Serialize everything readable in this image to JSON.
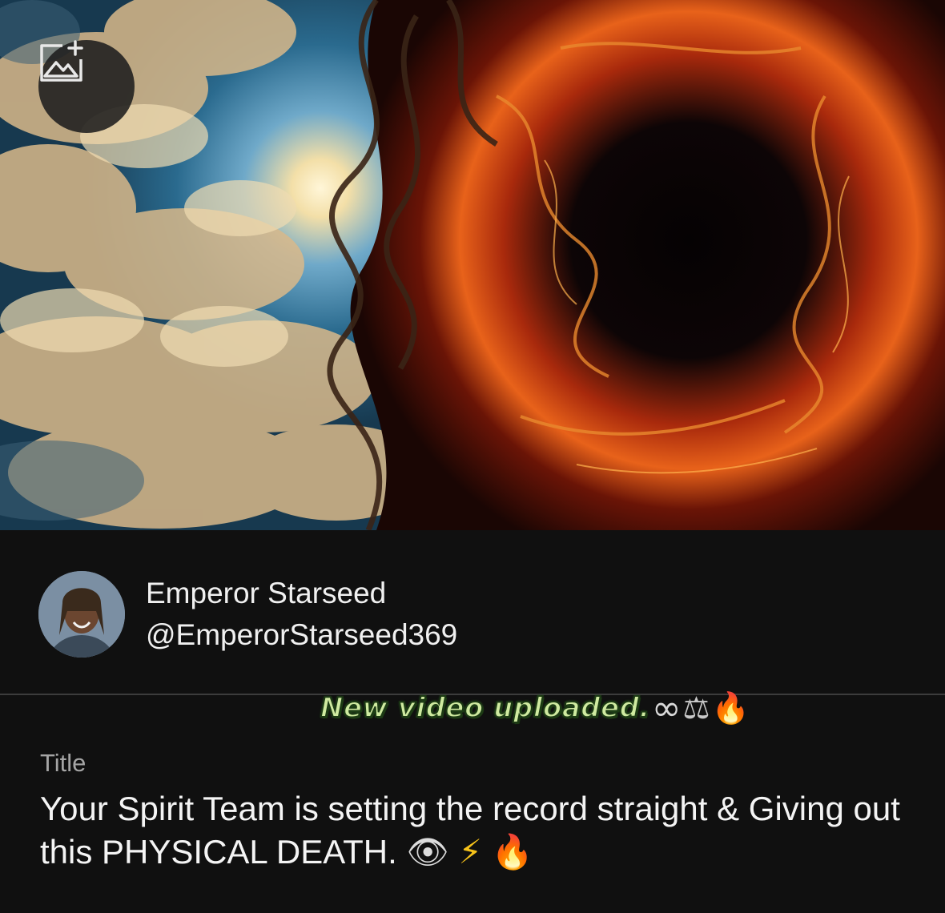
{
  "cover": {
    "add_image_icon": "image-add-icon"
  },
  "author": {
    "name": "Emperor Starseed",
    "handle": "@EmperorStarseed369"
  },
  "sticker": {
    "text": "New video uploaded.",
    "emoji_infinity": "∞",
    "emoji_scale": "⚖",
    "emoji_fire": "🔥"
  },
  "post": {
    "title_label": "Title",
    "title_text": "Your Spirit Team is setting the record straight & Giving out this PHYSICAL DEATH.",
    "title_emoji_eye": "👁",
    "title_emoji_bolt": "⚡",
    "title_emoji_fire": "🔥"
  },
  "colors": {
    "background": "#101010",
    "text": "#f2f2f2",
    "muted": "#a5a5a5",
    "sticker_green": "#cfeaa0"
  }
}
